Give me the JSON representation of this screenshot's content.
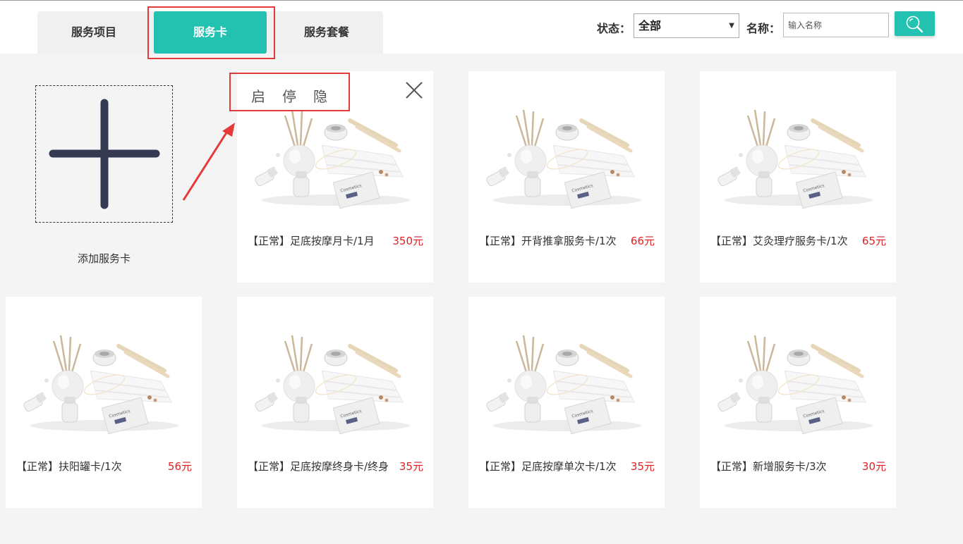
{
  "tabs": [
    {
      "label": "服务项目"
    },
    {
      "label": "服务卡"
    },
    {
      "label": "服务套餐"
    }
  ],
  "filter": {
    "status_label": "状态：",
    "status_value": "全部",
    "name_label": "名称：",
    "name_placeholder": "输入名称"
  },
  "add_card": {
    "label": "添加服务卡"
  },
  "card_actions": {
    "enable": "启",
    "disable": "停",
    "hide": "隐"
  },
  "cards": [
    {
      "title": "【正常】足底按摩月卡/1月",
      "price": "350元"
    },
    {
      "title": "【正常】开背推拿服务卡/1次",
      "price": "66元"
    },
    {
      "title": "【正常】艾灸理疗服务卡/1次",
      "price": "65元"
    },
    {
      "title": "【正常】扶阳罐卡/1次",
      "price": "56元"
    },
    {
      "title": "【正常】足底按摩终身卡/终身",
      "price": "35元"
    },
    {
      "title": "【正常】足底按摩单次卡/1次",
      "price": "35元"
    },
    {
      "title": "【正常】新增服务卡/3次",
      "price": "30元"
    }
  ],
  "colors": {
    "accent": "#22c1b0",
    "price": "#e21f1f",
    "highlight": "#e53a3a"
  }
}
